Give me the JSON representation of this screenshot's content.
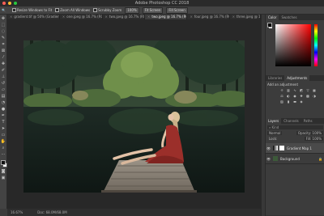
{
  "window": {
    "title": "Adobe Photoshop CC 2018",
    "controls": [
      "close",
      "minimize",
      "zoom"
    ]
  },
  "options_bar": {
    "resize_windows_label": "Resize Windows to Fit",
    "zoom_all_windows_label": "Zoom All Windows",
    "scrubby_zoom_label": "Scrubby Zoom",
    "zoom_value": "100%",
    "fit_screen_label": "Fit Screen",
    "fill_screen_label": "Fill Screen"
  },
  "tabs": [
    {
      "label": "gradient.tif @ 50% (Gradient Map 1, ...",
      "active": false
    },
    {
      "label": "one.jpeg @ 16.7% (RGB/8#) *",
      "active": false
    },
    {
      "label": "two.jpeg @ 16.7% (RGB/8#) *",
      "active": false
    },
    {
      "label": "two.jpeg @ 16.7% (RGB/8#) *",
      "active": true
    },
    {
      "label": "four.jpeg @ 16.7% (RGB/8#...",
      "active": false
    },
    {
      "label": "three.jpeg @ 16.7%",
      "active": false
    }
  ],
  "status_bar": {
    "zoom": "16.67%",
    "doc": "Doc: 68.0M/68.0M"
  },
  "panels": {
    "color_tabs": [
      "Color",
      "Swatches"
    ],
    "adjust_tabs": [
      "Libraries",
      "Adjustments"
    ],
    "adjust_title": "Add an adjustment",
    "layer_tabs": [
      "Layers",
      "Channels",
      "Paths"
    ],
    "filter_label": "Kind",
    "blend_mode": "Normal",
    "opacity": "Opacity: 100%",
    "lock_label": "Lock:",
    "fill": "Fill: 100%",
    "layers": [
      {
        "name": "Gradient Map 1",
        "selected": true
      },
      {
        "name": "Background",
        "selected": false
      }
    ]
  },
  "colors": {
    "foreground": "#000000",
    "background": "#ffffff",
    "accent": "#1473e6"
  }
}
